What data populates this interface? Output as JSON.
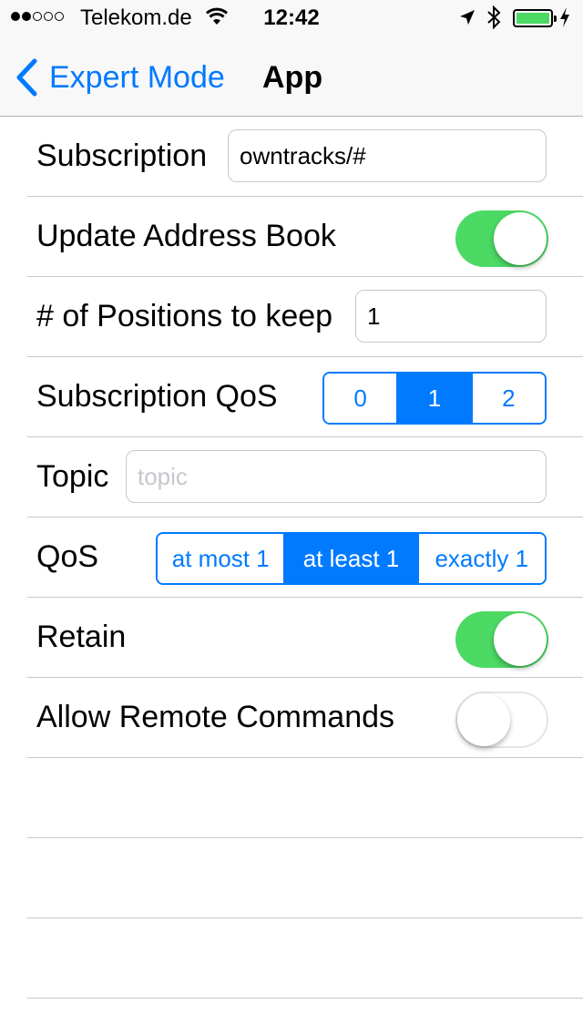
{
  "status_bar": {
    "carrier": "Telekom.de",
    "time": "12:42",
    "signal_bars_filled": 2,
    "signal_bars_total": 5,
    "battery_level": 1.0
  },
  "nav": {
    "back_label": "Expert Mode",
    "title": "App"
  },
  "settings": {
    "subscription": {
      "label": "Subscription",
      "value": "owntracks/#"
    },
    "update_address_book": {
      "label": "Update Address Book",
      "on": true
    },
    "positions_to_keep": {
      "label": "# of Positions to keep",
      "value": "1"
    },
    "subscription_qos": {
      "label": "Subscription QoS",
      "options": [
        "0",
        "1",
        "2"
      ],
      "selected": 1
    },
    "topic": {
      "label": "Topic",
      "value": "",
      "placeholder": "topic"
    },
    "qos": {
      "label": "QoS",
      "options": [
        "at most 1",
        "at least 1",
        "exactly 1"
      ],
      "selected": 1
    },
    "retain": {
      "label": "Retain",
      "on": true
    },
    "allow_remote_commands": {
      "label": "Allow Remote Commands",
      "on": false
    }
  },
  "colors": {
    "accent": "#007aff",
    "switch_on": "#4cd964",
    "separator": "#c8c7cc"
  }
}
